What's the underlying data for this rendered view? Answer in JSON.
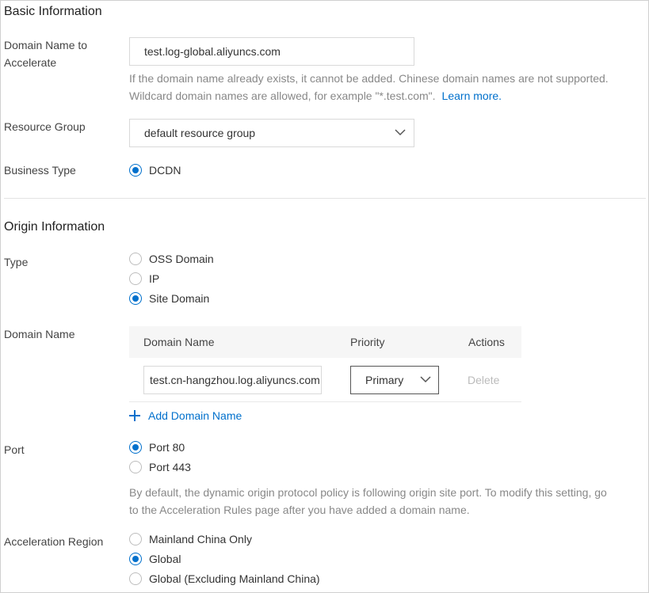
{
  "basic": {
    "section_title": "Basic Information",
    "domain_label_line1": "Domain Name to",
    "domain_label_line2": "Accelerate",
    "domain_value": "test.log-global.aliyuncs.com",
    "help_line1": "If the domain name already exists, it cannot be added. Chinese domain names are not supported.",
    "help_line2": "Wildcard domain names are allowed, for example \"*.test.com\".",
    "learn_more": "Learn more.",
    "resource_group_label": "Resource Group",
    "resource_group_value": "default resource group",
    "business_type_label": "Business Type",
    "business_type_option": "DCDN"
  },
  "origin": {
    "section_title": "Origin Information",
    "type_label": "Type",
    "type_options": [
      {
        "label": "OSS Domain",
        "selected": false
      },
      {
        "label": "IP",
        "selected": false
      },
      {
        "label": "Site Domain",
        "selected": true
      }
    ],
    "domain_name_label": "Domain Name",
    "table": {
      "headers": [
        "Domain Name",
        "Priority",
        "Actions"
      ],
      "row": {
        "domain": "test.cn-hangzhou.log.aliyuncs.com",
        "priority": "Primary",
        "action": "Delete"
      }
    },
    "add_domain": "Add Domain Name",
    "port_label": "Port",
    "port_options": [
      {
        "label": "Port 80",
        "selected": true
      },
      {
        "label": "Port 443",
        "selected": false
      }
    ],
    "port_help_line1": "By default, the dynamic origin protocol policy is following origin site port. To modify this setting, go",
    "port_help_line2": "to the Acceleration Rules page after you have added a domain name.",
    "region_label": "Acceleration Region",
    "region_options": [
      {
        "label": "Mainland China Only",
        "selected": false
      },
      {
        "label": "Global",
        "selected": true
      },
      {
        "label": "Global (Excluding Mainland China)",
        "selected": false
      }
    ]
  },
  "colors": {
    "accent": "#0070cc",
    "muted": "#888888",
    "border": "#d9d9d9"
  },
  "icons": [
    "chevron-down-icon",
    "plus-icon",
    "radio-icon"
  ]
}
